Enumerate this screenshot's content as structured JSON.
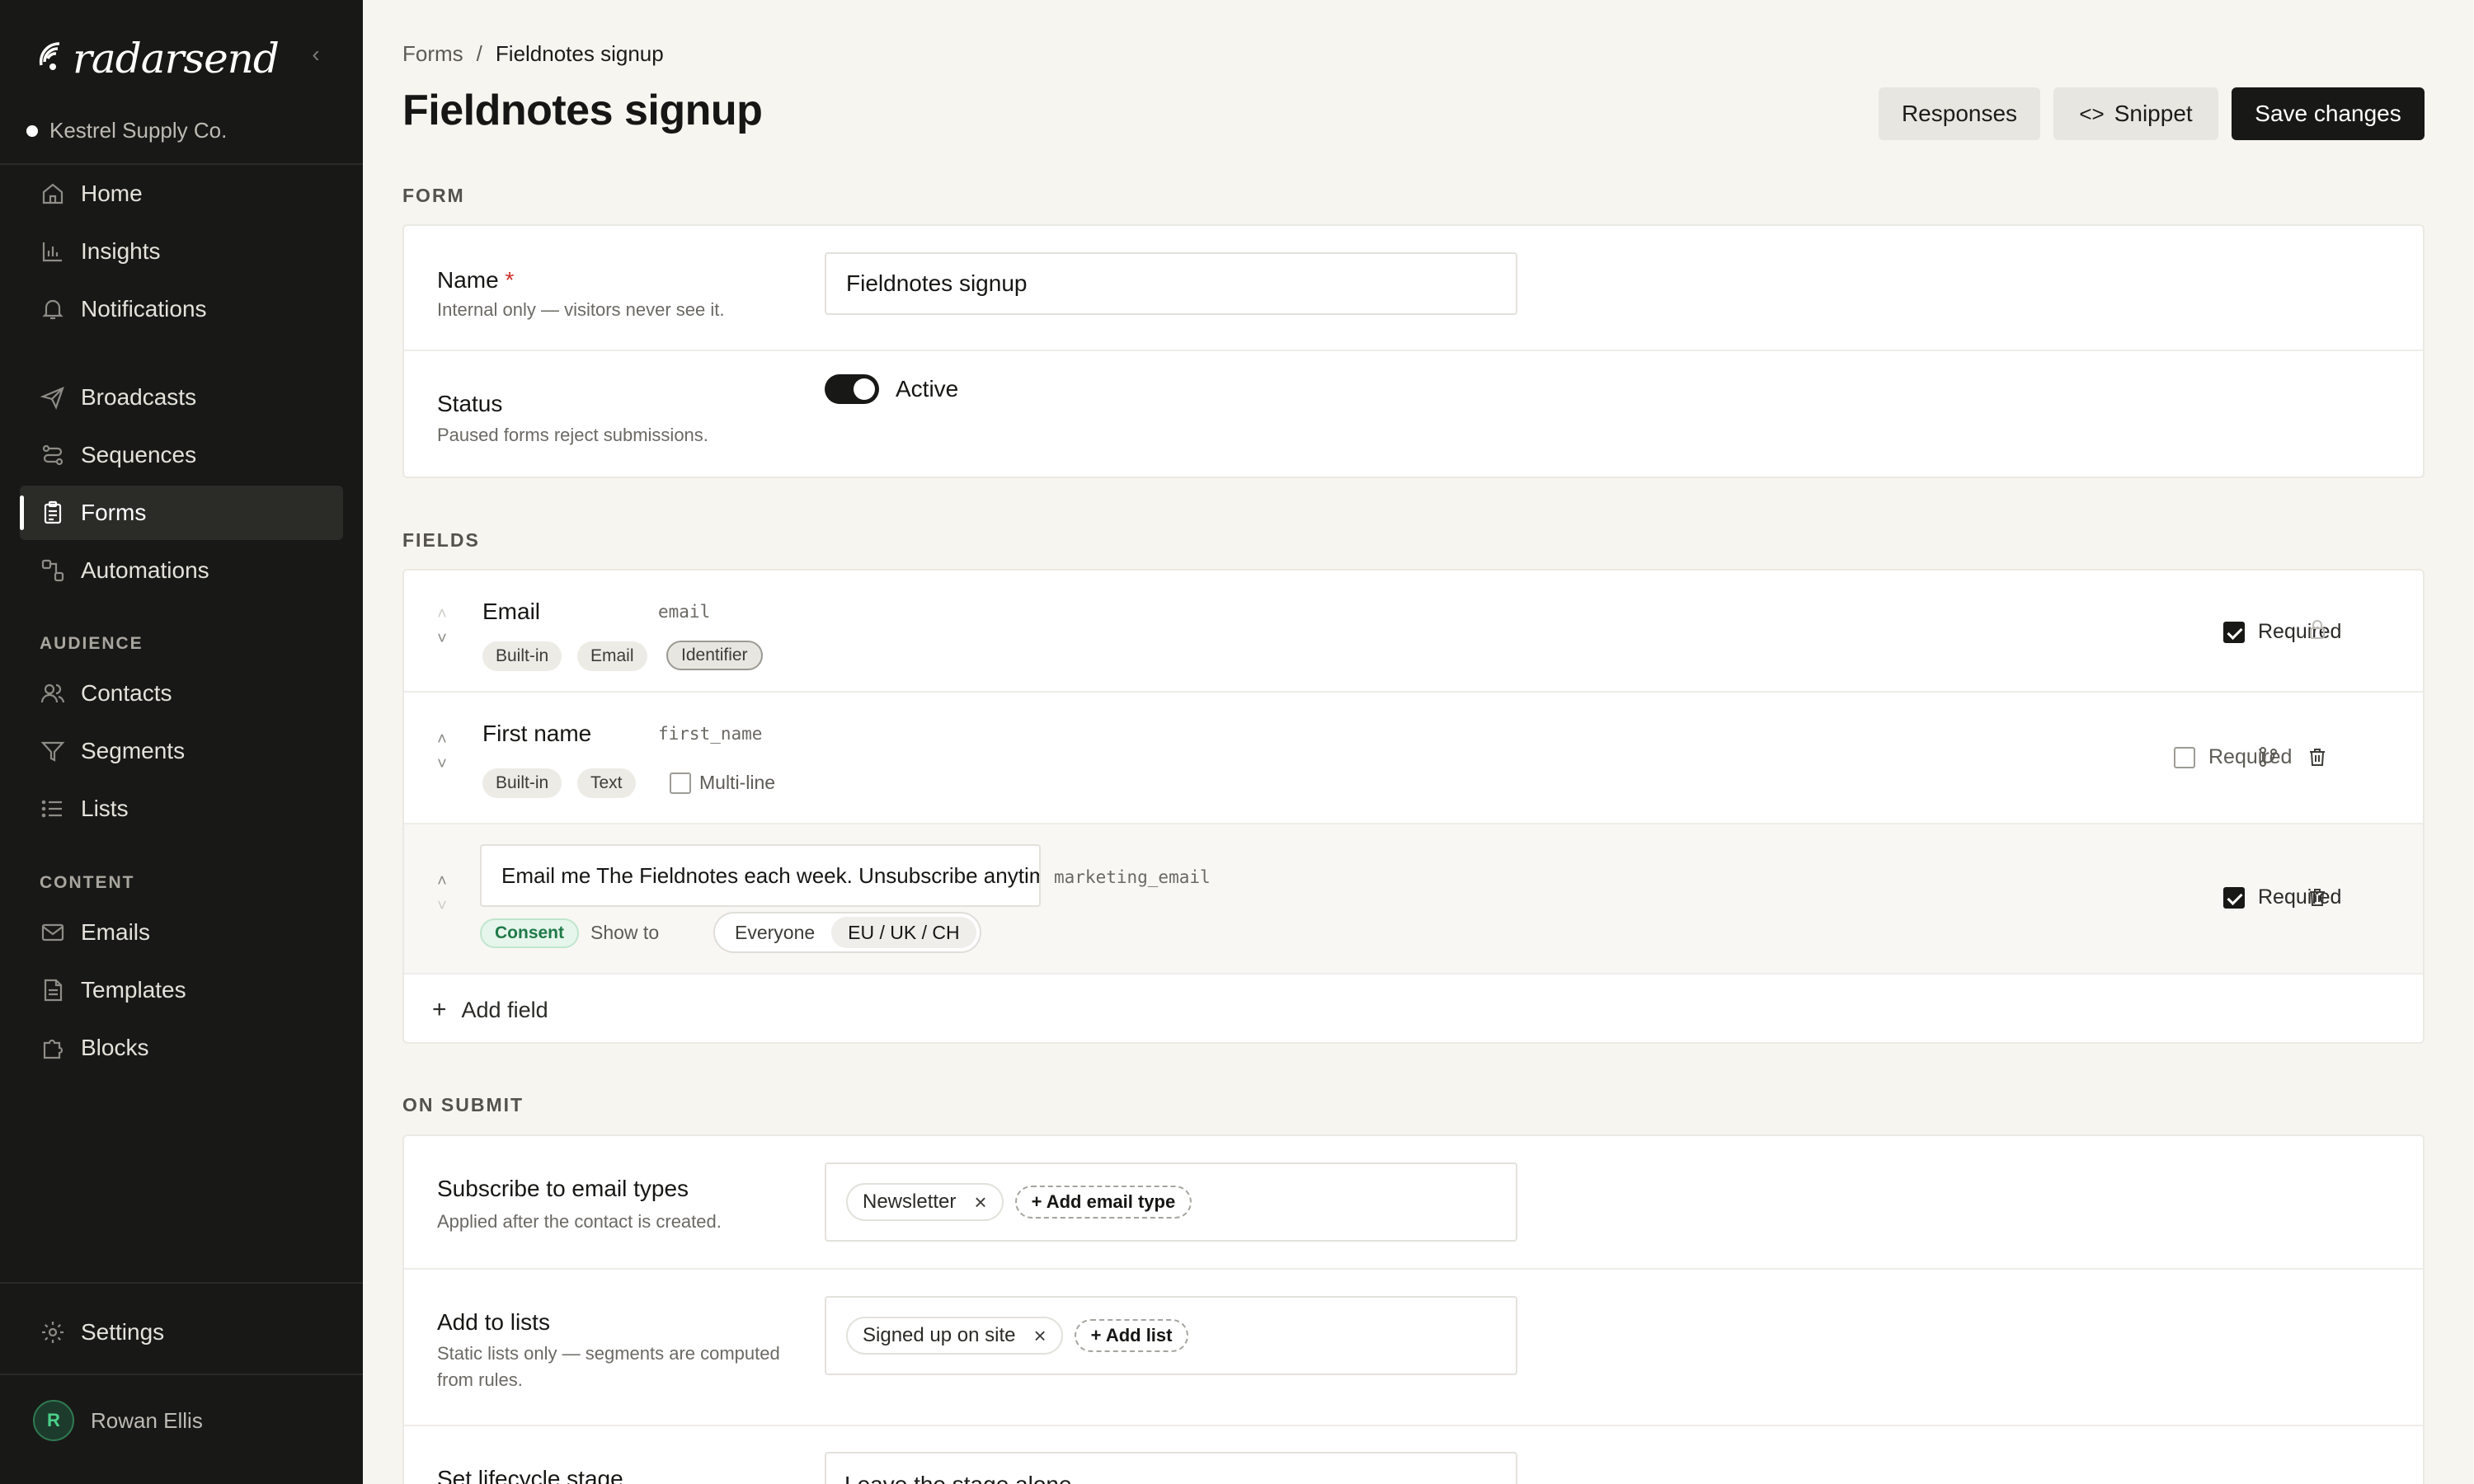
{
  "app": {
    "brand": "radarsend",
    "workspace": "Kestrel Supply Co.",
    "collapse_icon": "chevron-left-icon"
  },
  "sidebar": {
    "primary": [
      {
        "label": "Home",
        "icon": "home-icon"
      },
      {
        "label": "Insights",
        "icon": "bar-chart-icon"
      },
      {
        "label": "Notifications",
        "icon": "bell-icon"
      }
    ],
    "messaging": [
      {
        "label": "Broadcasts",
        "icon": "send-icon"
      },
      {
        "label": "Sequences",
        "icon": "sequence-icon"
      },
      {
        "label": "Forms",
        "icon": "clipboard-icon",
        "active": true
      },
      {
        "label": "Automations",
        "icon": "automation-icon"
      }
    ],
    "audience_label": "AUDIENCE",
    "audience": [
      {
        "label": "Contacts",
        "icon": "users-icon"
      },
      {
        "label": "Segments",
        "icon": "filter-icon"
      },
      {
        "label": "Lists",
        "icon": "list-icon"
      }
    ],
    "content_label": "CONTENT",
    "content": [
      {
        "label": "Emails",
        "icon": "mail-icon"
      },
      {
        "label": "Templates",
        "icon": "document-icon"
      },
      {
        "label": "Blocks",
        "icon": "puzzle-icon"
      }
    ],
    "settings": {
      "label": "Settings",
      "icon": "gear-icon"
    },
    "user": {
      "initial": "R",
      "name": "Rowan Ellis"
    }
  },
  "breadcrumb": {
    "parent": "Forms",
    "separator": "/",
    "current": "Fieldnotes signup"
  },
  "header": {
    "title": "Fieldnotes signup",
    "responses_label": "Responses",
    "snippet_label": "Snippet",
    "snippet_icon": "code-icon",
    "save_label": "Save changes"
  },
  "form_section": {
    "label": "FORM",
    "name_label": "Name",
    "name_required_mark": "*",
    "name_help": "Internal only — visitors never see it.",
    "name_value": "Fieldnotes signup",
    "status_label": "Status",
    "status_help": "Paused forms reject submissions.",
    "status_value": "Active",
    "status_on": true
  },
  "fields_section": {
    "label": "FIELDS",
    "fields": [
      {
        "name": "Email",
        "key": "email",
        "chips": [
          "Built-in",
          "Email",
          "Identifier"
        ],
        "required_label": "Required",
        "required": true,
        "action_icon": "lock-icon"
      },
      {
        "name": "First name",
        "key": "first_name",
        "chips": [
          "Built-in",
          "Text"
        ],
        "multiline_label": "Multi-line",
        "multiline": false,
        "required_label": "Required",
        "required": false,
        "action_icons": [
          "branch-icon",
          "trash-icon"
        ]
      },
      {
        "name_input": "Email me The Fieldnotes each week. Unsubscribe anytime.",
        "key": "marketing_email",
        "chip": "Consent",
        "show_to_label": "Show to",
        "show_to_options": [
          "Everyone",
          "EU / UK / CH"
        ],
        "show_to_selected": "EU / UK / CH",
        "required_label": "Required",
        "required": true,
        "action_icon": "trash-icon"
      }
    ],
    "add_field_label": "Add field",
    "add_field_icon": "plus-icon"
  },
  "on_submit": {
    "label": "ON SUBMIT",
    "email_types_label": "Subscribe to email types",
    "email_types_help": "Applied after the contact is created.",
    "email_types": [
      "Newsletter"
    ],
    "add_email_type_label": "+ Add email type",
    "lists_label": "Add to lists",
    "lists_help": "Static lists only — segments are computed from rules.",
    "lists": [
      "Signed up on site"
    ],
    "add_list_label": "+ Add list",
    "lifecycle_label": "Set lifecycle stage",
    "lifecycle_value": "Leave the stage alone"
  }
}
